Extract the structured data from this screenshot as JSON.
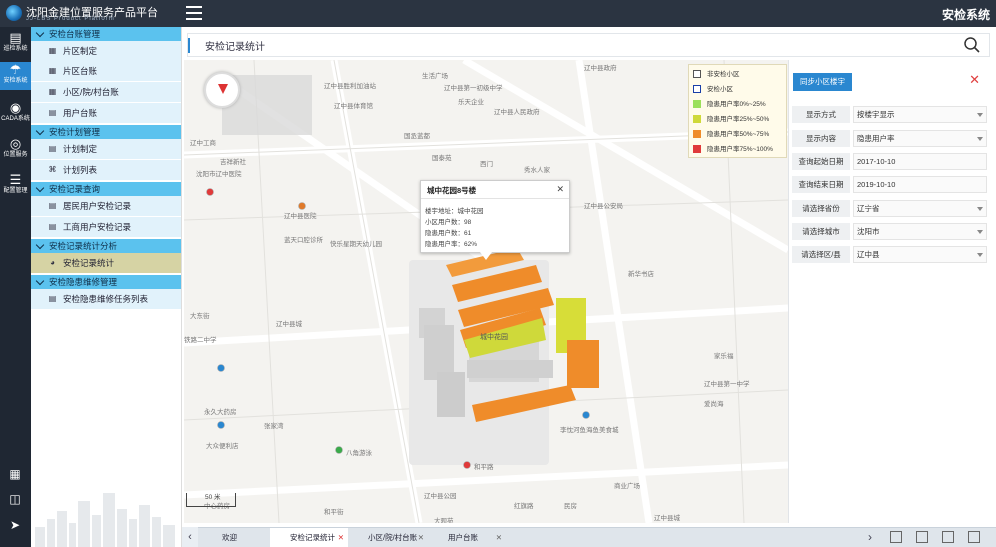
{
  "app": {
    "title": "沈阳金建位置服务产品平台",
    "subtitle": "JJ-LBS Product Platform",
    "system_title": "安检系统"
  },
  "rail": {
    "items": [
      {
        "label": "巡检系统",
        "icon": "clipboard-icon"
      },
      {
        "label": "安检系统",
        "icon": "shield-icon"
      },
      {
        "label": "CADA系统",
        "icon": "globe-icon"
      },
      {
        "label": "位置服务",
        "icon": "location-icon"
      },
      {
        "label": "配置管理",
        "icon": "sliders-icon"
      }
    ],
    "bottom_icons": [
      "apps-grid-icon",
      "add-window-icon",
      "arrow-right-circle-icon"
    ]
  },
  "sidebar": {
    "groups": [
      {
        "label": "安检台账管理",
        "items": [
          "片区制定",
          "片区台账",
          "小区/院/村台账",
          "用户台账"
        ]
      },
      {
        "label": "安检计划管理",
        "items": [
          "计划制定",
          "计划列表"
        ]
      },
      {
        "label": "安检记录查询",
        "items": [
          "居民用户安检记录",
          "工商用户安检记录"
        ]
      },
      {
        "label": "安检记录统计分析",
        "items": [
          "安检记录统计"
        ]
      },
      {
        "label": "安检隐患维修管理",
        "items": [
          "安检隐患维修任务列表"
        ]
      }
    ]
  },
  "search": {
    "value": "安检记录统计",
    "placeholder": ""
  },
  "map": {
    "labels": [
      "生活广场",
      "辽中县政府",
      "辽中县胜利加油站",
      "辽中县第一初级中学",
      "辽中县体育馆",
      "乐天企业",
      "辽中县人民政府",
      "辽中工商",
      "国丞蓝都",
      "国泰苑",
      "沈阳市辽中医院",
      "吉祥新社",
      "西门",
      "秀水人家",
      "辽中县公安局",
      "辽中县医院",
      "蓝天口腔诊所",
      "快乐星期天幼儿园",
      "铁路二中学",
      "辽中县城",
      "新华书店",
      "大东街",
      "辽中县第一中学",
      "爱尚海",
      "永久大药房",
      "张家湾",
      "家乐福",
      "大众便利店",
      "八角游泳",
      "李忱河鱼海鱼美食城",
      "和平路",
      "辽中县公园",
      "商业广场",
      "红旗路",
      "和平街",
      "大观苑",
      "辽中县城",
      "民房",
      "中心药房"
    ],
    "scale_label": "50 米",
    "building_label": "城中花园"
  },
  "legend": [
    {
      "label": "非安检小区",
      "color": "#ffffff"
    },
    {
      "label": "安检小区",
      "color": "#1a3fa8"
    },
    {
      "label": "隐患用户率0%~25%",
      "color": "#9be05a"
    },
    {
      "label": "隐患用户率25%~50%",
      "color": "#cfd93a"
    },
    {
      "label": "隐患用户率50%~75%",
      "color": "#ef8c2a"
    },
    {
      "label": "隐患用户率75%~100%",
      "color": "#e03a3a"
    }
  ],
  "popup": {
    "title": "城中花园8号楼",
    "address": "楼宇地址：城中花园",
    "total": "小区用户数：98",
    "hazard": "隐患用户数：61",
    "rate": "隐患用户率：62%"
  },
  "panel": {
    "sync_label": "同步小区楼宇",
    "rows": [
      {
        "label": "显示方式",
        "value": "按楼宇显示",
        "dropdown": true
      },
      {
        "label": "显示内容",
        "value": "隐患用户率",
        "dropdown": true
      },
      {
        "label": "查询起始日期",
        "value": "2017-10-10",
        "dropdown": false
      },
      {
        "label": "查询结束日期",
        "value": "2019-10-10",
        "dropdown": false
      },
      {
        "label": "请选择省份",
        "value": "辽宁省",
        "dropdown": true
      },
      {
        "label": "请选择城市",
        "value": "沈阳市",
        "dropdown": true
      },
      {
        "label": "请选择区/县",
        "value": "辽中县",
        "dropdown": true
      }
    ]
  },
  "tabs": [
    {
      "label": "欢迎",
      "active": false
    },
    {
      "label": "安检记录统计",
      "active": true
    },
    {
      "label": "小区/院/村台账",
      "active": false
    },
    {
      "label": "用户台账",
      "active": false
    }
  ],
  "colors": {
    "accent": "#2a87d0",
    "sidebar_group": "#5bc2ee",
    "sidebar_item": "#e1f2fb",
    "topbar": "#2b3441"
  }
}
